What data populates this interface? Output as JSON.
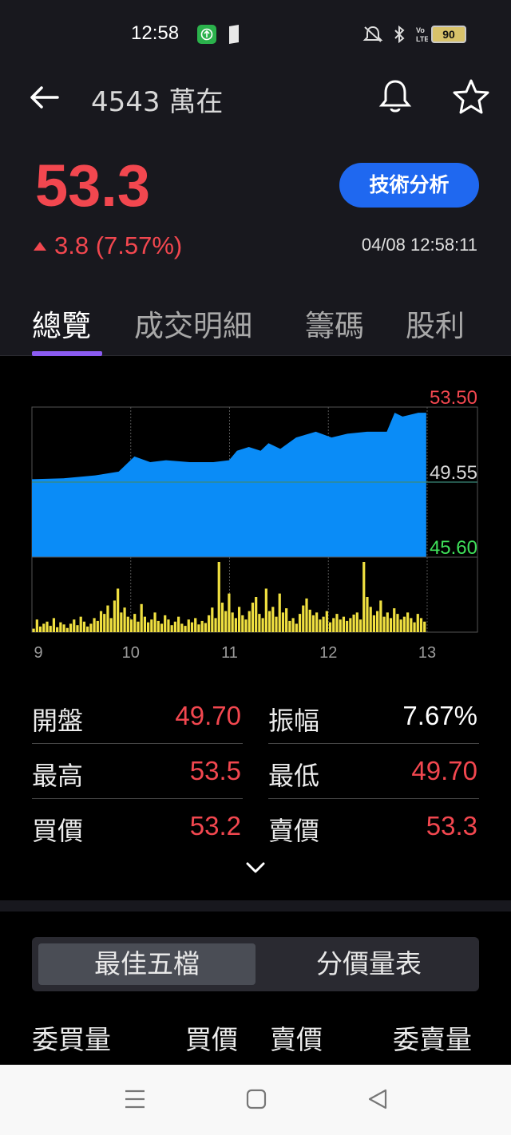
{
  "status_bar": {
    "time": "12:58",
    "battery": "90",
    "icons": [
      "app-notification-icon",
      "document-icon",
      "mute-icon",
      "bluetooth-icon",
      "volte-icon",
      "4g-signal-icon",
      "battery-icon"
    ]
  },
  "header": {
    "title": "4543 萬在",
    "price": "53.3",
    "change": "3.8 (7.57%)",
    "timestamp": "04/08 12:58:11",
    "tech_button": "技術分析"
  },
  "tabs": [
    {
      "label": "總覽",
      "active": true
    },
    {
      "label": "成交明細",
      "active": false
    },
    {
      "label": "籌碼",
      "active": false
    },
    {
      "label": "股利",
      "active": false
    }
  ],
  "chart_data": {
    "type": "area",
    "x_tick_labels": [
      "9",
      "10",
      "11",
      "12",
      "13"
    ],
    "price_axis_labels": {
      "high": "53.50",
      "reference": "49.55",
      "low": "45.60"
    },
    "ylim": [
      45.6,
      53.5
    ],
    "reference": 49.55,
    "colors": {
      "area": "#0a8cf7",
      "volume": "#f0e040",
      "high": "#f2474f",
      "low": "#3fe05a",
      "reference": "#d8d8d8"
    },
    "price": [
      [
        0.0,
        49.7
      ],
      [
        0.08,
        49.75
      ],
      [
        0.16,
        49.9
      ],
      [
        0.22,
        50.1
      ],
      [
        0.26,
        50.9
      ],
      [
        0.3,
        50.6
      ],
      [
        0.34,
        50.7
      ],
      [
        0.4,
        50.6
      ],
      [
        0.46,
        50.6
      ],
      [
        0.5,
        50.7
      ],
      [
        0.52,
        51.2
      ],
      [
        0.55,
        51.4
      ],
      [
        0.58,
        51.2
      ],
      [
        0.6,
        51.6
      ],
      [
        0.63,
        51.3
      ],
      [
        0.67,
        51.9
      ],
      [
        0.72,
        52.2
      ],
      [
        0.76,
        51.9
      ],
      [
        0.8,
        52.1
      ],
      [
        0.85,
        52.2
      ],
      [
        0.9,
        52.2
      ],
      [
        0.92,
        53.2
      ],
      [
        0.94,
        53.0
      ],
      [
        0.96,
        53.1
      ],
      [
        0.98,
        53.2
      ],
      [
        1.0,
        53.2
      ]
    ],
    "volume": [
      0.05,
      0.18,
      0.08,
      0.12,
      0.15,
      0.09,
      0.2,
      0.07,
      0.14,
      0.11,
      0.06,
      0.12,
      0.18,
      0.1,
      0.22,
      0.15,
      0.08,
      0.12,
      0.2,
      0.16,
      0.3,
      0.26,
      0.38,
      0.2,
      0.45,
      0.62,
      0.28,
      0.35,
      0.22,
      0.18,
      0.26,
      0.15,
      0.4,
      0.22,
      0.14,
      0.18,
      0.28,
      0.16,
      0.12,
      0.24,
      0.18,
      0.1,
      0.15,
      0.22,
      0.12,
      0.09,
      0.18,
      0.14,
      0.2,
      0.11,
      0.16,
      0.13,
      0.24,
      0.35,
      0.2,
      1.0,
      0.42,
      0.3,
      0.55,
      0.28,
      0.2,
      0.36,
      0.24,
      0.18,
      0.3,
      0.42,
      0.5,
      0.26,
      0.2,
      0.62,
      0.3,
      0.36,
      0.22,
      0.55,
      0.28,
      0.34,
      0.16,
      0.2,
      0.12,
      0.26,
      0.38,
      0.48,
      0.32,
      0.24,
      0.28,
      0.18,
      0.22,
      0.3,
      0.14,
      0.2,
      0.26,
      0.18,
      0.22,
      0.16,
      0.2,
      0.25,
      0.28,
      0.18,
      1.0,
      0.5,
      0.36,
      0.24,
      0.3,
      0.45,
      0.22,
      0.28,
      0.2,
      0.34,
      0.26,
      0.18,
      0.22,
      0.28,
      0.2,
      0.14,
      0.26,
      0.2,
      0.15
    ]
  },
  "stats": [
    [
      {
        "label": "開盤",
        "value": "49.70",
        "color": "#f2474f"
      },
      {
        "label": "振幅",
        "value": "7.67%",
        "color": "#ffffff"
      }
    ],
    [
      {
        "label": "最高",
        "value": "53.5",
        "color": "#f2474f"
      },
      {
        "label": "最低",
        "value": "49.70",
        "color": "#f2474f"
      }
    ],
    [
      {
        "label": "買價",
        "value": "53.2",
        "color": "#f2474f"
      },
      {
        "label": "賣價",
        "value": "53.3",
        "color": "#f2474f"
      }
    ]
  ],
  "order_book": {
    "segments": [
      {
        "label": "最佳五檔",
        "active": true
      },
      {
        "label": "分價量表",
        "active": false
      }
    ],
    "headers": [
      "委買量",
      "買價",
      "賣價",
      "委賣量"
    ]
  }
}
